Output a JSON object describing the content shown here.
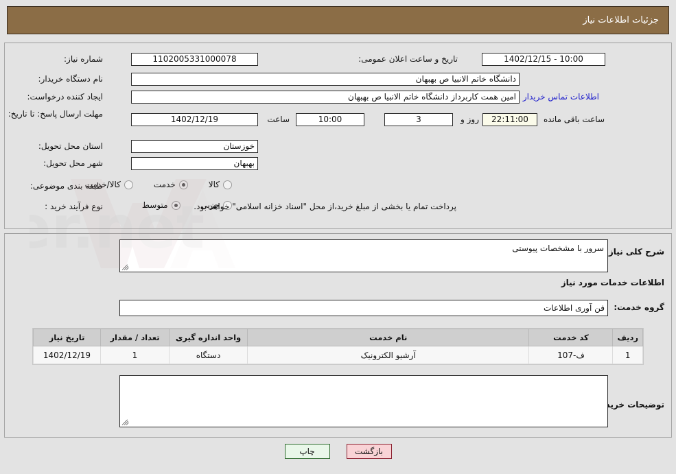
{
  "header": {
    "title": "جزئیات اطلاعات نیاز"
  },
  "form": {
    "need_number_label": "شماره نیاز:",
    "need_number_value": "1102005331000078",
    "announce_label": "تاریخ و ساعت اعلان عمومی:",
    "announce_value": "10:00 - 1402/12/15",
    "buyer_org_label": "نام دستگاه خریدار:",
    "buyer_org_value": "دانشگاه خاتم الانبیا  ص  بهبهان",
    "requester_label": "ایجاد کننده درخواست:",
    "requester_value": "امین همت کاربرداز دانشگاه خاتم الانبیا  ص  بهبهان",
    "contact_link": "اطلاعات تماس خریدار",
    "deadline_label": "مهلت ارسال پاسخ: تا تاریخ:",
    "deadline_date": "1402/12/19",
    "deadline_hour_label": "ساعت",
    "deadline_hour_value": "10:00",
    "remaining_days_value": "3",
    "remaining_days_label": "روز و",
    "remaining_time_value": "22:11:00",
    "remaining_time_label": "ساعت باقی مانده",
    "province_label": "استان محل تحویل:",
    "province_value": "خوزستان",
    "city_label": "شهر محل تحویل:",
    "city_value": "بهبهان",
    "category_label": "طبقه بندی موضوعی:",
    "category_options": [
      {
        "label": "کالا",
        "selected": false
      },
      {
        "label": "خدمت",
        "selected": true
      },
      {
        "label": "کالا/خدمت",
        "selected": false
      }
    ],
    "process_label": "نوع فرآیند خرید :",
    "process_options": [
      {
        "label": "جزیی",
        "selected": false
      },
      {
        "label": "متوسط",
        "selected": true
      }
    ],
    "payment_note": "پرداخت تمام یا بخشی از مبلغ خرید،از محل \"اسناد خزانه اسلامی\" خواهد بود."
  },
  "detail": {
    "general_desc_label": "شرح کلی نیاز:",
    "general_desc_value": "سرور با مشخصات پیوستی",
    "services_section_title": "اطلاعات خدمات مورد نیاز",
    "service_group_label": "گروه خدمت:",
    "service_group_value": "فن آوری اطلاعات",
    "buyer_notes_label": "توضیحات خریدار:",
    "buyer_notes_value": ""
  },
  "table": {
    "columns": [
      "ردیف",
      "کد خدمت",
      "نام خدمت",
      "واحد اندازه گیری",
      "تعداد / مقدار",
      "تاریخ نیاز"
    ],
    "rows": [
      {
        "row_no": "1",
        "service_code": "ف-107",
        "service_name": "آرشیو الکترونیک",
        "unit": "دستگاه",
        "quantity": "1",
        "need_date": "1402/12/19"
      }
    ]
  },
  "buttons": {
    "back": "بازگشت",
    "print": "چاپ"
  },
  "watermark": {
    "text": "AnaTender.net"
  }
}
